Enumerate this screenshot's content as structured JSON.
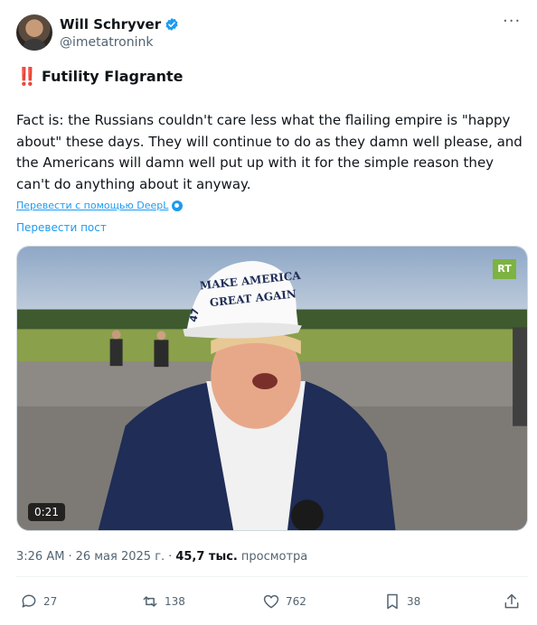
{
  "author": {
    "display_name": "Will Schryver",
    "handle": "@imetatronink"
  },
  "post": {
    "title_emoji": "‼️",
    "title": "Futility Flagrante",
    "body": "Fact is: the Russians couldn't care less what the flailing empire is \"happy about\" these days. They will continue to do as they damn well please, and the Americans will damn well put up with it for the simple reason they can't do anything about it anyway.",
    "deepl_link": "Перевести с помощью DeepL",
    "translate_link": "Перевести пост"
  },
  "video": {
    "duration": "0:21",
    "channel_logo": "RT",
    "hat_text_line1": "MAKE AMERICA",
    "hat_text_line2": "GREAT AGAIN",
    "hat_side": "47"
  },
  "meta": {
    "time": "3:26 AM",
    "separator": "·",
    "date": "26 мая 2025 г.",
    "views_count": "45,7 тыс.",
    "views_label": "просмотра"
  },
  "actions": {
    "replies": "27",
    "reposts": "138",
    "likes": "762",
    "bookmarks": "38"
  },
  "colors": {
    "accent": "#1d9bf0",
    "text": "#0f1419",
    "muted": "#536471"
  }
}
